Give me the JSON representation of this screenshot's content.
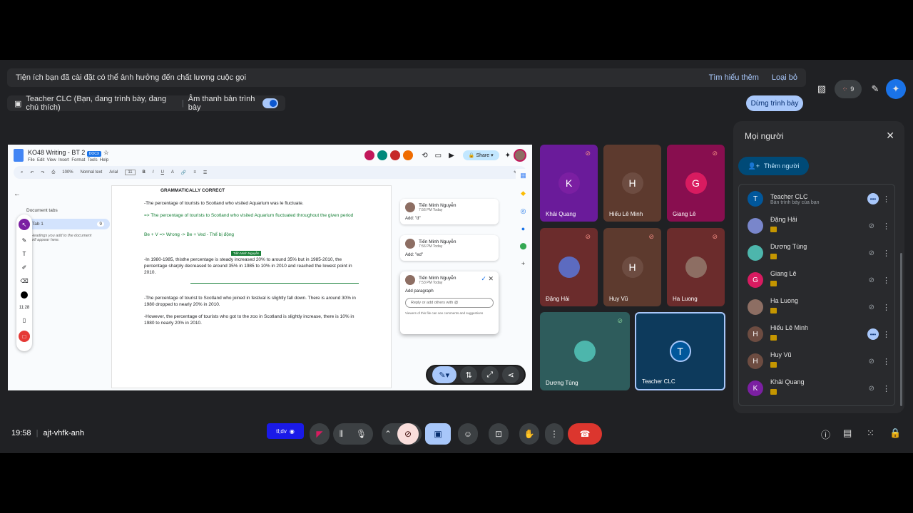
{
  "banner": {
    "message": "Tiện ích bạn đã cài đặt có thể ảnh hưởng đến chất lượng cuộc gọi",
    "learn_more": "Tìm hiểu thêm",
    "remove": "Loại bỏ"
  },
  "presenting": {
    "label": "Teacher CLC (Bạn, đang trình bày, đang chú thích)",
    "audio_label": "Âm thanh bản trình bày",
    "stop_button": "Dừng trình bày"
  },
  "top_right": {
    "participant_count": "9"
  },
  "doc": {
    "title": "KO48 Writing - BT 2",
    "format_badge": "DOCX",
    "menu": [
      "File",
      "Edit",
      "View",
      "Insert",
      "Format",
      "Tools",
      "Help"
    ],
    "share_label": "Share",
    "zoom": "100%",
    "style": "Normal text",
    "font": "Arial",
    "font_size": "11",
    "tabs_header": "Document tabs",
    "tab_name": "Tab 1",
    "tab_count": "9",
    "tabs_hint": "Headings you add to the document will appear here.",
    "anno_time": "11:28",
    "heading": "GRAMMATICALLY CORRECT",
    "para1": "-The percentage of tourists to Scotland who visited Aquarium was le fluctuate.",
    "para2": "=> The percentage of tourists to Scotland who visited Aquarium fluctuated throughout the given period",
    "para3": "Be + V => Wrong -> Be + Ved - Thể bị động",
    "cursor_tag": "Tiến Minh Nguyễn",
    "para4": "-In 1980-1985, thisthe percentage is steady increased 20% to around 35% but in 1985-2010, the percentage sharply decreased to around 35% in 1985 to 10% in 2010 and reached the lowest point in 2010.",
    "para5": "-The percentage of tourist to Scotland who joined in festival is slightly fall down. There is around 30% in 1980 dropped to nearly 20% in 2010.",
    "para6": "-However, the percentage of tourists who got to the zoo in  Scotland is slightly increase, there is 10% in 1980 to nearly 20% in  2010."
  },
  "comments": [
    {
      "name": "Tiến Minh Nguyễn",
      "time": "7:56 PM Today",
      "text": "Add: \"d\""
    },
    {
      "name": "Tiến Minh Nguyễn",
      "time": "7:56 PM Today",
      "text": "Add: \"ed\""
    },
    {
      "name": "Tiến Minh Nguyễn",
      "time": "7:53 PM Today",
      "text": "Add paragraph",
      "reply_placeholder": "Reply or add others with @",
      "note": "Viewers of this file can see comments and suggestions"
    }
  ],
  "tiles": [
    {
      "name": "Khải Quang",
      "initial": "K",
      "color": "#6a1b9a",
      "avatar_color": "#7b1fa2"
    },
    {
      "name": "Hiếu Lê Minh",
      "initial": "H",
      "color": "#5d3a2e",
      "avatar_color": "#6d4c41"
    },
    {
      "name": "Giang Lê",
      "initial": "G",
      "color": "#880e4f",
      "avatar_color": "#d81b60"
    },
    {
      "name": "Đặng Hải",
      "initial": "",
      "color": "#6b2c2c",
      "avatar_color": "#5c6bc0"
    },
    {
      "name": "Huy Vũ",
      "initial": "H",
      "color": "#5d3a2e",
      "avatar_color": "#6d4c41"
    },
    {
      "name": "Ha Luong",
      "initial": "",
      "color": "#6b2c2c",
      "avatar_color": "#8d6e63"
    },
    {
      "name": "Dương Tùng",
      "initial": "",
      "color": "#2e5c5c",
      "avatar_color": "#4db6ac"
    },
    {
      "name": "Teacher CLC",
      "initial": "T",
      "color": "#0d3a5c",
      "avatar_color": "#01579b"
    }
  ],
  "people": {
    "title": "Mọi người",
    "add_button": "Thêm người",
    "list": [
      {
        "name": "Teacher CLC",
        "sub": "Bản trình bày của bạn",
        "initial": "T",
        "color": "#01579b"
      },
      {
        "name": "Đặng Hải",
        "sub": "",
        "initial": "",
        "color": "#7986cb"
      },
      {
        "name": "Dương Tùng",
        "sub": "",
        "initial": "",
        "color": "#4db6ac"
      },
      {
        "name": "Giang Lê",
        "sub": "",
        "initial": "G",
        "color": "#d81b60"
      },
      {
        "name": "Ha Luong",
        "sub": "",
        "initial": "",
        "color": "#8d6e63"
      },
      {
        "name": "Hiếu Lê Minh",
        "sub": "",
        "initial": "H",
        "color": "#6d4c41"
      },
      {
        "name": "Huy Vũ",
        "sub": "",
        "initial": "H",
        "color": "#6d4c41"
      },
      {
        "name": "Khải Quang",
        "sub": "",
        "initial": "K",
        "color": "#7b1fa2"
      }
    ]
  },
  "bottom": {
    "time": "19:58",
    "meeting_code": "ajt-vhfk-anh",
    "ext_label": "tl;dv"
  }
}
